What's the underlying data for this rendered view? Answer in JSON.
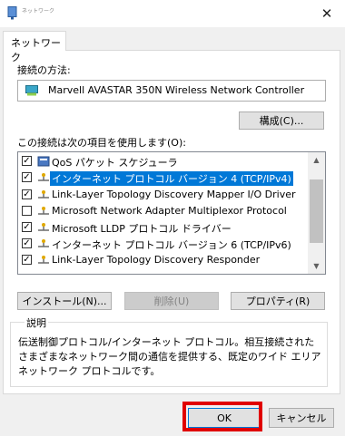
{
  "window": {
    "title": "ネットワーク",
    "close_glyph": "✕"
  },
  "tabs": [
    {
      "label": "ネットワーク",
      "active": true
    }
  ],
  "connect_using": {
    "label": "接続の方法:",
    "adapter": "Marvell AVASTAR 350N Wireless Network Controller",
    "configure_button": "構成(C)..."
  },
  "items_section": {
    "label": "この接続は次の項目を使用します(O):",
    "items": [
      {
        "label": "QoS パケット スケジューラ",
        "checked": true,
        "selected": false,
        "icon": "qos-scheduler-icon"
      },
      {
        "label": "インターネット プロトコル バージョン 4 (TCP/IPv4)",
        "checked": true,
        "selected": true,
        "icon": "protocol-icon"
      },
      {
        "label": "Link-Layer Topology Discovery Mapper I/O Driver",
        "checked": true,
        "selected": false,
        "icon": "protocol-icon"
      },
      {
        "label": "Microsoft Network Adapter Multiplexor Protocol",
        "checked": false,
        "selected": false,
        "icon": "protocol-icon"
      },
      {
        "label": "Microsoft LLDP プロトコル ドライバー",
        "checked": true,
        "selected": false,
        "icon": "protocol-icon"
      },
      {
        "label": "インターネット プロトコル バージョン 6 (TCP/IPv6)",
        "checked": true,
        "selected": false,
        "icon": "protocol-icon"
      },
      {
        "label": "Link-Layer Topology Discovery Responder",
        "checked": true,
        "selected": false,
        "icon": "protocol-icon"
      }
    ]
  },
  "buttons": {
    "install": "インストール(N)...",
    "uninstall": "削除(U)",
    "properties": "プロパティ(R)",
    "ok": "OK",
    "cancel": "キャンセル"
  },
  "description": {
    "title": "説明",
    "text": "伝送制御プロトコル/インターネット プロトコル。相互接続されたさまざまなネットワーク間の通信を提供する、既定のワイド エリア ネットワーク プロトコルです。"
  },
  "colors": {
    "selection": "#0078d7",
    "highlight_box": "#e00000"
  }
}
